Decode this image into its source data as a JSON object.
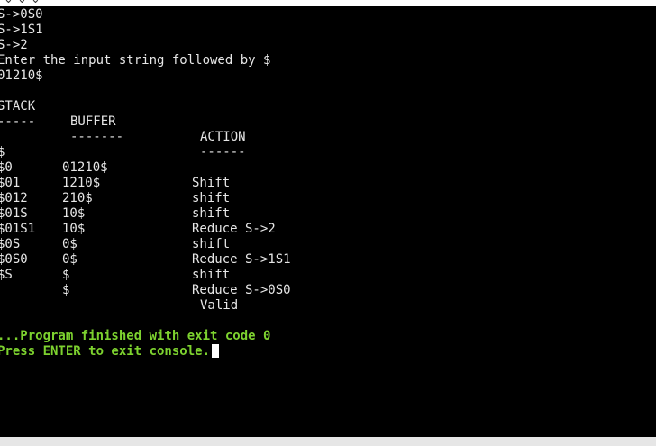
{
  "window_strip": {
    "left_glyphs": "⌄ ⌄ ⌄",
    "right_glyph": "'"
  },
  "grammar": [
    "S->0S0",
    "S->1S1",
    "S->2"
  ],
  "prompt": "Enter the input string followed by $",
  "user_input": "01210$",
  "table": {
    "headers": {
      "stack": "STACK",
      "buffer": "BUFFER",
      "action": "ACTION"
    },
    "underlines": {
      "stack": "-----",
      "buffer": "-------",
      "action": "------"
    },
    "rows": [
      {
        "stack": "$",
        "buffer": "01210$",
        "action": "Shift"
      },
      {
        "stack": "$0",
        "buffer": "1210$",
        "action": "shift"
      },
      {
        "stack": "$01",
        "buffer": "210$",
        "action": "shift"
      },
      {
        "stack": "$012",
        "buffer": "10$",
        "action": "Reduce S->2"
      },
      {
        "stack": "$01S",
        "buffer": "10$",
        "action": "shift"
      },
      {
        "stack": "$01S1",
        "buffer": "0$",
        "action": "Reduce S->1S1"
      },
      {
        "stack": "$0S",
        "buffer": "0$",
        "action": "shift"
      },
      {
        "stack": "$0S0",
        "buffer": "$",
        "action": "Reduce S->0S0"
      },
      {
        "stack": "$S",
        "buffer": "$",
        "action": "Valid"
      }
    ]
  },
  "footer": {
    "finished": "...Program finished with exit code 0",
    "press_enter": "Press ENTER to exit console."
  },
  "colors": {
    "background": "#000000",
    "text": "#e6e6e6",
    "status": "#7dd22f"
  }
}
